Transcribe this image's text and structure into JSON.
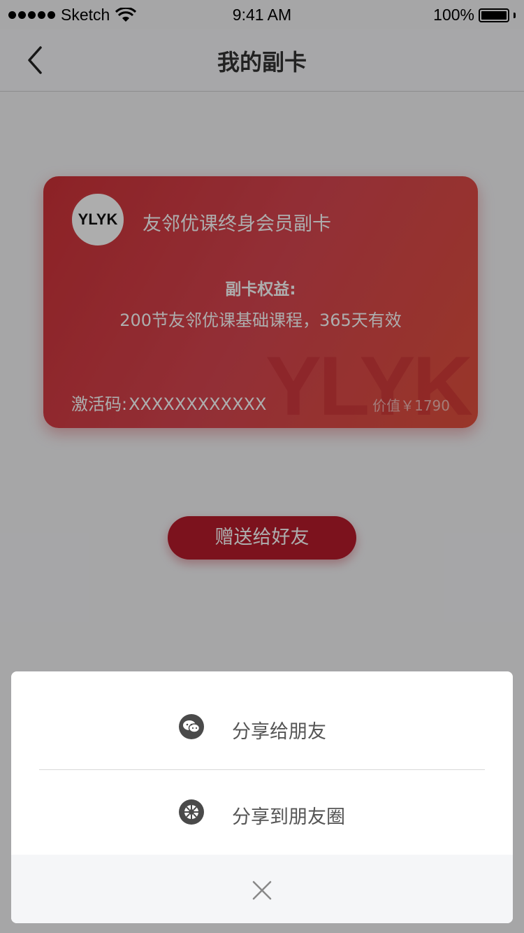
{
  "status_bar": {
    "carrier": "Sketch",
    "time": "9:41 AM",
    "battery": "100%"
  },
  "nav": {
    "title": "我的副卡",
    "back_icon": "chevron-left-icon"
  },
  "card": {
    "logo_text": "YLYK",
    "title": "友邻优课终身会员副卡",
    "benefits_label": "副卡权益:",
    "benefits_text": "200节友邻优课基础课程，365天有效",
    "activation_label": "激活码:",
    "activation_code": "XXXXXXXXXXXX",
    "price": "价值￥1790",
    "watermark": "YLYK"
  },
  "gift_button": {
    "label": "赠送给好友"
  },
  "share_sheet": {
    "items": [
      {
        "label": "分享给朋友",
        "icon": "wechat-icon"
      },
      {
        "label": "分享到朋友圈",
        "icon": "moments-icon"
      }
    ],
    "close_icon": "close-icon"
  },
  "colors": {
    "card_start": "#cf3238",
    "card_end": "#e2503d",
    "button": "#b71b2c",
    "overlay": "rgba(0,0,0,0.32)"
  }
}
